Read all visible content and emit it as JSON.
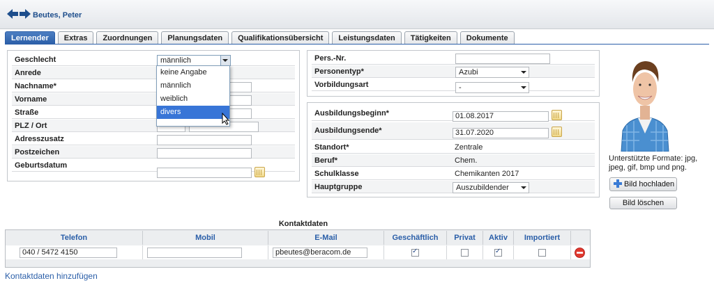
{
  "header": {
    "name": "Beutes, Peter"
  },
  "tabs": [
    "Lernender",
    "Extras",
    "Zuordnungen",
    "Planungsdaten",
    "Qualifikationsübersicht",
    "Leistungsdaten",
    "Tätigkeiten",
    "Dokumente"
  ],
  "left_form": {
    "geschlecht_label": "Geschlecht",
    "geschlecht_value": "männlich",
    "anrede_label": "Anrede",
    "nachname_label": "Nachname*",
    "vorname_label": "Vorname",
    "strasse_label": "Straße",
    "plz_label": "PLZ / Ort",
    "adresszusatz_label": "Adresszusatz",
    "postzeichen_label": "Postzeichen",
    "geburtsdatum_label": "Geburtsdatum"
  },
  "dropdown_options": [
    "keine Angabe",
    "männlich",
    "weiblich",
    "divers"
  ],
  "right_top": {
    "persnr_label": "Pers.-Nr.",
    "personentyp_label": "Personentyp*",
    "personentyp_value": "Azubi",
    "vorbildung_label": "Vorbildungsart",
    "vorbildung_value": "-"
  },
  "right_mid": {
    "beginn_label": "Ausbildungsbeginn*",
    "beginn_value": "01.08.2017",
    "ende_label": "Ausbildungsende*",
    "ende_value": "31.07.2020",
    "standort_label": "Standort*",
    "standort_value": "Zentrale",
    "beruf_label": "Beruf*",
    "beruf_value": "Chem.",
    "schulklasse_label": "Schulklasse",
    "schulklasse_value": "Chemikanten 2017",
    "hauptgruppe_label": "Hauptgruppe",
    "hauptgruppe_value": "Auszubildender"
  },
  "photo": {
    "formats_text": "Unterstützte Formate: jpg, jpeg, gif, bmp und png.",
    "upload_label": "Bild hochladen",
    "delete_label": "Bild löschen"
  },
  "contacts": {
    "title": "Kontaktdaten",
    "headers": [
      "Telefon",
      "Mobil",
      "E-Mail",
      "Geschäftlich",
      "Privat",
      "Aktiv",
      "Importiert"
    ],
    "row": {
      "telefon": "040 / 5472 4150",
      "mobil": "",
      "email": "pbeutes@beracom.de",
      "geschaeftlich": true,
      "privat": false,
      "aktiv": true,
      "importiert": false
    },
    "add_link": "Kontaktdaten hinzufügen"
  }
}
